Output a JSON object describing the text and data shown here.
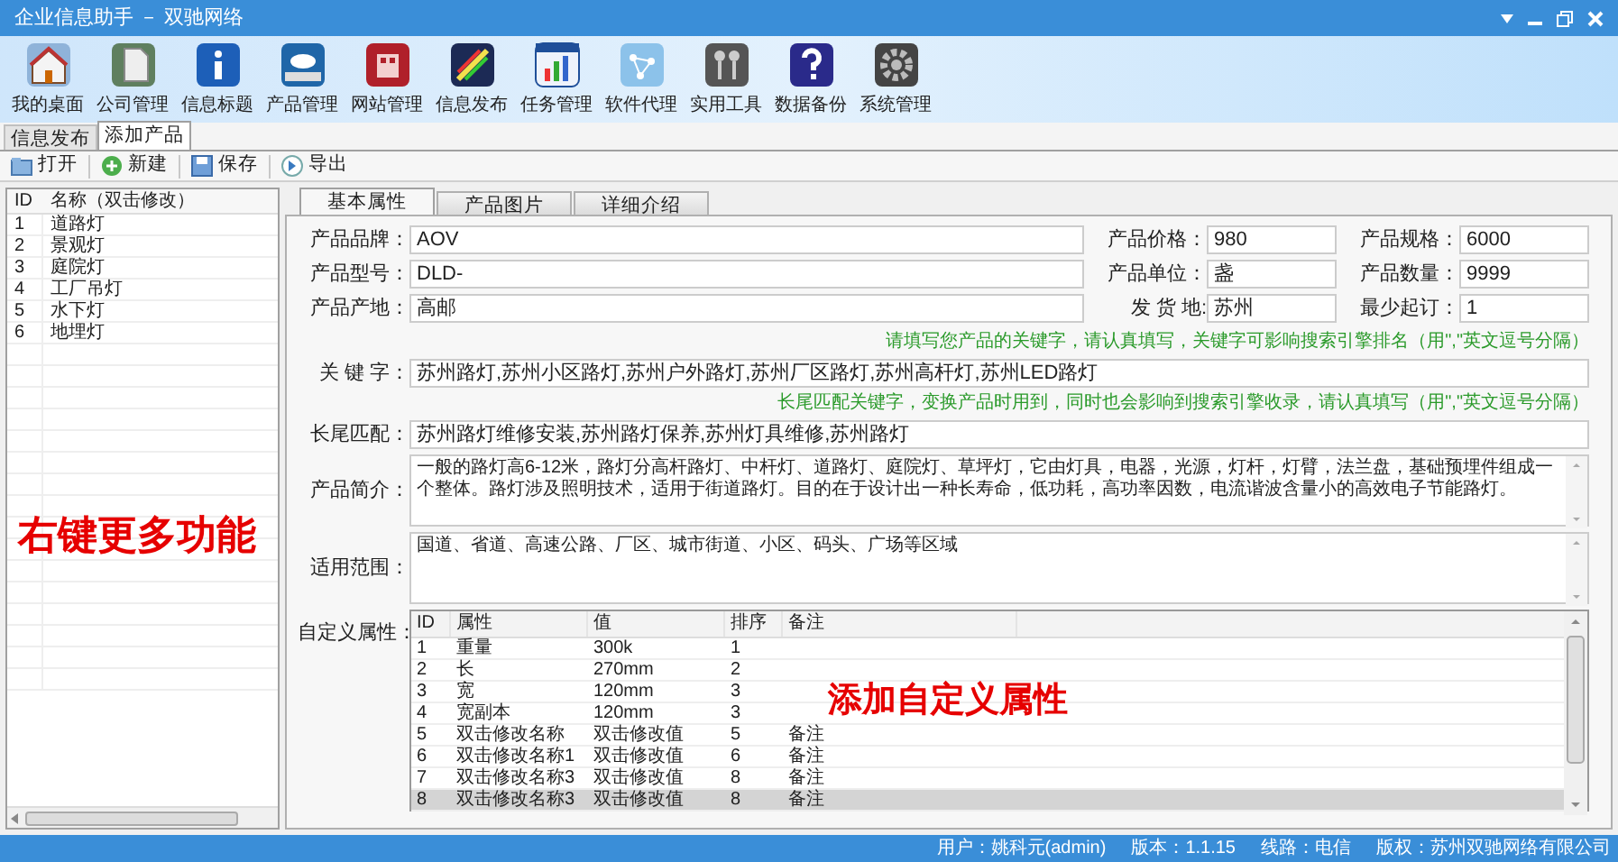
{
  "window": {
    "title": "企业信息助手 － 双驰网络"
  },
  "toolbar": [
    {
      "label": "我的桌面"
    },
    {
      "label": "公司管理"
    },
    {
      "label": "信息标题"
    },
    {
      "label": "产品管理"
    },
    {
      "label": "网站管理"
    },
    {
      "label": "信息发布"
    },
    {
      "label": "任务管理"
    },
    {
      "label": "软件代理"
    },
    {
      "label": "实用工具"
    },
    {
      "label": "数据备份"
    },
    {
      "label": "系统管理"
    }
  ],
  "doc_tabs": [
    {
      "label": "信息发布",
      "selected": false
    },
    {
      "label": "添加产品",
      "selected": true
    }
  ],
  "actions": [
    {
      "label": "打开",
      "kind": "open"
    },
    {
      "label": "新建",
      "kind": "new"
    },
    {
      "label": "保存",
      "kind": "save"
    },
    {
      "label": "导出",
      "kind": "export"
    }
  ],
  "product_list": {
    "columns": [
      "ID",
      "名称（双击修改）"
    ],
    "rows": [
      [
        "1",
        "道路灯"
      ],
      [
        "2",
        "景观灯"
      ],
      [
        "3",
        "庭院灯"
      ],
      [
        "4",
        "工厂吊灯"
      ],
      [
        "5",
        "水下灯"
      ],
      [
        "6",
        "地埋灯"
      ]
    ],
    "overlay": "右键更多功能"
  },
  "form_tabs": [
    {
      "label": "基本属性",
      "selected": true
    },
    {
      "label": "产品图片",
      "selected": false
    },
    {
      "label": "详细介绍",
      "selected": false
    }
  ],
  "field_rows": [
    [
      {
        "label": "产品品牌：",
        "value": "AOV"
      },
      {
        "label": "产品价格：",
        "value": "980"
      },
      {
        "label": "产品规格：",
        "value": "6000"
      }
    ],
    [
      {
        "label": "产品型号：",
        "value": "DLD-"
      },
      {
        "label": "产品单位：",
        "value": "盏"
      },
      {
        "label": "产品数量：",
        "value": "9999"
      }
    ],
    [
      {
        "label": "产品产地：",
        "value": "高邮"
      },
      {
        "label": "发 货 地:",
        "value": "苏州"
      },
      {
        "label": "最少起订：",
        "value": "1"
      }
    ]
  ],
  "keyword_hint": "请填写您产品的关键字，请认真填写，关键字可影响搜索引擎排名（用\",\"英文逗号分隔）",
  "keywords": {
    "label": "关 键 字：",
    "value": "苏州路灯,苏州小区路灯,苏州户外路灯,苏州厂区路灯,苏州高杆灯,苏州LED路灯"
  },
  "longtail_hint": "长尾匹配关键字，变换产品时用到，同时也会影响到搜索引擎收录，请认真填写（用\",\"英文逗号分隔）",
  "longtail": {
    "label": "长尾匹配：",
    "value": "苏州路灯维修安装,苏州路灯保养,苏州灯具维修,苏州路灯"
  },
  "intro": {
    "label": "产品简介：",
    "value": "一般的路灯高6-12米，路灯分高杆路灯、中杆灯、道路灯、庭院灯、草坪灯，它由灯具，电器，光源，灯杆，灯臂，法兰盘，基础预埋件组成一个整体。路灯涉及照明技术，适用于街道路灯。目的在于设计出一种长寿命，低功耗，高功率因数，电流谐波含量小的高效电子节能路灯。"
  },
  "scope": {
    "label": "适用范围：",
    "value": "国道、省道、高速公路、厂区、城市街道、小区、码头、广场等区域"
  },
  "custom_attributes": {
    "label": "自定义属性：",
    "columns": [
      "ID",
      "属性",
      "值",
      "排序",
      "备注"
    ],
    "overlay": "添加自定义属性",
    "rows": [
      {
        "cells": [
          "1",
          "重量",
          "300k",
          "1",
          ""
        ],
        "selected": false
      },
      {
        "cells": [
          "2",
          "长",
          "270mm",
          "2",
          ""
        ],
        "selected": false
      },
      {
        "cells": [
          "3",
          "宽",
          "120mm",
          "3",
          ""
        ],
        "selected": false
      },
      {
        "cells": [
          "4",
          "宽副本",
          "120mm",
          "3",
          ""
        ],
        "selected": false
      },
      {
        "cells": [
          "5",
          "双击修改名称",
          "双击修改值",
          "5",
          "备注"
        ],
        "selected": false
      },
      {
        "cells": [
          "6",
          "双击修改名称1",
          "双击修改值",
          "6",
          "备注"
        ],
        "selected": false
      },
      {
        "cells": [
          "7",
          "双击修改名称3",
          "双击修改值",
          "8",
          "备注"
        ],
        "selected": false
      },
      {
        "cells": [
          "8",
          "双击修改名称3",
          "双击修改值",
          "8",
          "备注"
        ],
        "selected": true
      }
    ]
  },
  "status_bar": [
    "用户：姚科元(admin)",
    "版本：1.1.15",
    "线路：电信",
    "版权：苏州双驰网络有限公司"
  ]
}
